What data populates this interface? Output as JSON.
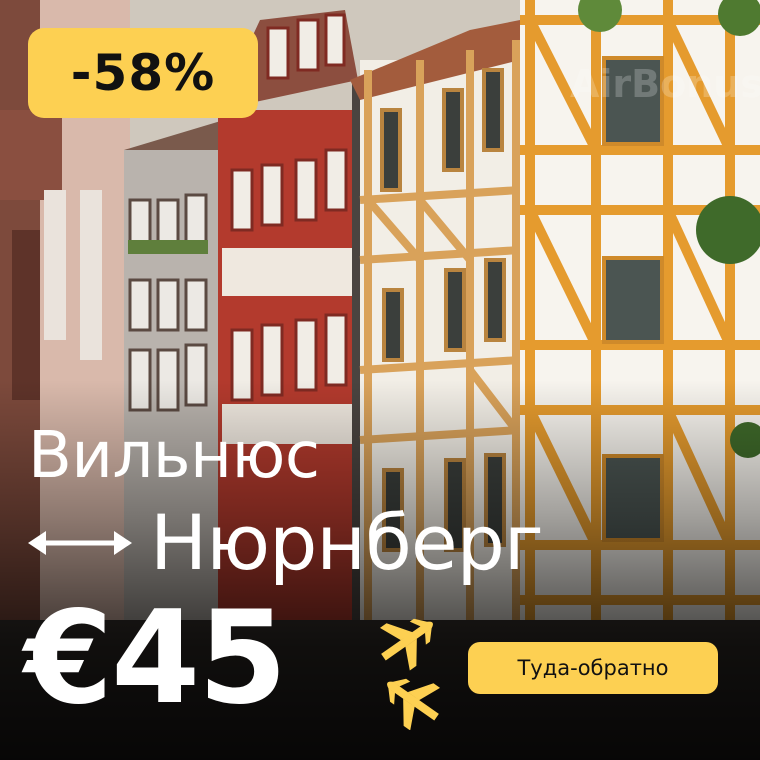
{
  "ad": {
    "discount": "-58%",
    "watermark": "AirBonus",
    "origin": "Вильнюс",
    "destination": "Нюрнберг",
    "price": "€45",
    "trip_type": "Туда-обратно"
  },
  "colors": {
    "accent": "#fdd052",
    "text": "#ffffff",
    "badge_text": "#111111"
  },
  "icons": [
    "round-trip-arrow-icon",
    "departure-plane-icon",
    "arrival-plane-icon"
  ]
}
